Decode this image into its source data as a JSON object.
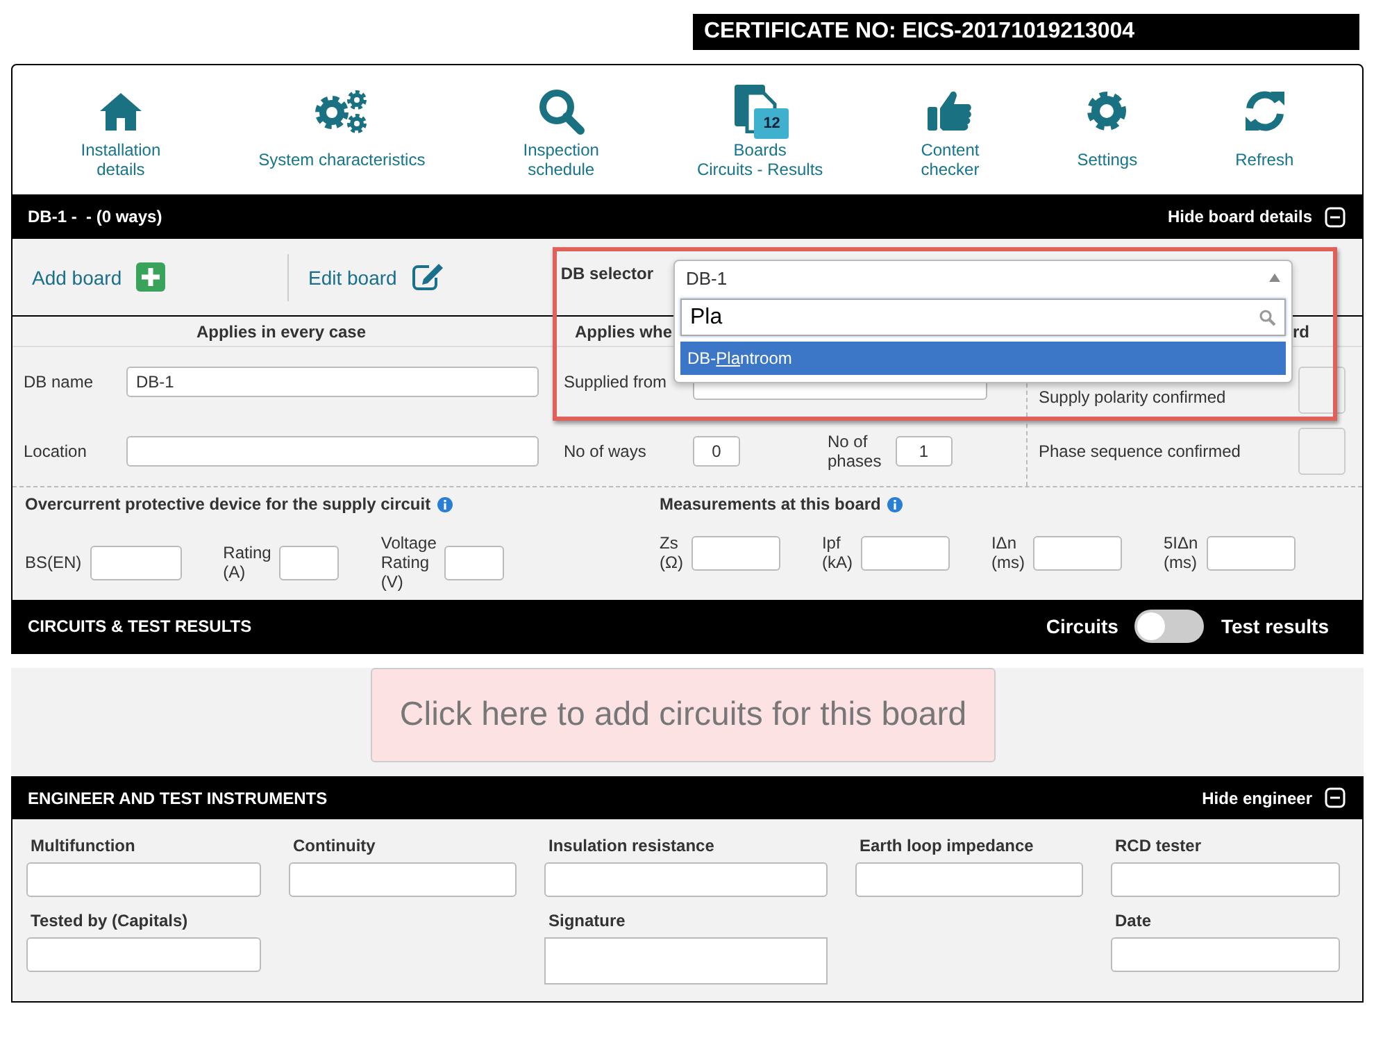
{
  "certificate": {
    "label": "CERTIFICATE NO: EICS-20171019213004"
  },
  "toolbar": [
    {
      "kind": "home",
      "label": "Installation\ndetails"
    },
    {
      "kind": "gears",
      "label": "System characteristics"
    },
    {
      "kind": "search",
      "label": "Inspection\nschedule"
    },
    {
      "kind": "boards",
      "label": "Boards\nCircuits - Results",
      "badge": "12"
    },
    {
      "kind": "thumb",
      "label": "Content\nchecker"
    },
    {
      "kind": "gear",
      "label": "Settings"
    },
    {
      "kind": "refresh",
      "label": "Refresh"
    }
  ],
  "board_header": {
    "title": "DB-1 -  - (0 ways)",
    "toggle_label": "Hide board details"
  },
  "board_actions": [
    {
      "kind": "add",
      "label": "Add board"
    },
    {
      "kind": "edit",
      "label": "Edit board"
    }
  ],
  "db_selector": {
    "label": "DB selector",
    "value": "DB-1",
    "expanded": true,
    "search": "Pla",
    "options": [
      {
        "prefix": "DB-",
        "match": "Pla",
        "rest": "ntroom",
        "selected": true
      }
    ]
  },
  "details": {
    "headings": [
      "Applies in every case",
      "Applies whe",
      "rd"
    ],
    "db_name": {
      "label": "DB name",
      "value": "DB-1"
    },
    "location": {
      "label": "Location"
    },
    "supplied_from": {
      "label": "Supplied from"
    },
    "no_of_ways": {
      "label": "No of ways",
      "value": "0"
    },
    "no_of_phases": {
      "label": "No of\nphases",
      "value": "1"
    },
    "confirmations": [
      {
        "label": "Supply polarity confirmed",
        "checked": false
      },
      {
        "label": "Phase sequence confirmed",
        "checked": false
      }
    ]
  },
  "overcurrent": {
    "heading": "Overcurrent protective device for the supply circuit",
    "fields": [
      {
        "label": "BS(EN)"
      },
      {
        "label": "Rating\n(A)"
      },
      {
        "label": "Voltage\nRating\n(V)"
      }
    ]
  },
  "measurements": {
    "heading": "Measurements at this board",
    "fields": [
      {
        "label": "Zs\n(Ω)"
      },
      {
        "label": "Ipf\n(kA)"
      },
      {
        "label": "IΔn\n(ms)"
      },
      {
        "label": "5IΔn\n(ms)"
      }
    ]
  },
  "circuits_bar": {
    "title": "CIRCUITS & TEST RESULTS",
    "left_label": "Circuits",
    "right_label": "Test results",
    "on": false
  },
  "add_circuits": {
    "label": "Click here to add circuits for this board"
  },
  "engineer": {
    "title": "ENGINEER AND TEST INSTRUMENTS",
    "toggle_label": "Hide engineer",
    "instruments": [
      {
        "label": "Multifunction"
      },
      {
        "label": "Continuity"
      },
      {
        "label": "Insulation resistance"
      },
      {
        "label": "Earth loop impedance"
      },
      {
        "label": "RCD tester"
      }
    ],
    "sign_off": [
      {
        "label": "Tested by (Capitals)",
        "kind": "text"
      },
      {
        "label": "Signature",
        "kind": "signature"
      },
      {
        "label": "Date",
        "kind": "text"
      }
    ]
  }
}
